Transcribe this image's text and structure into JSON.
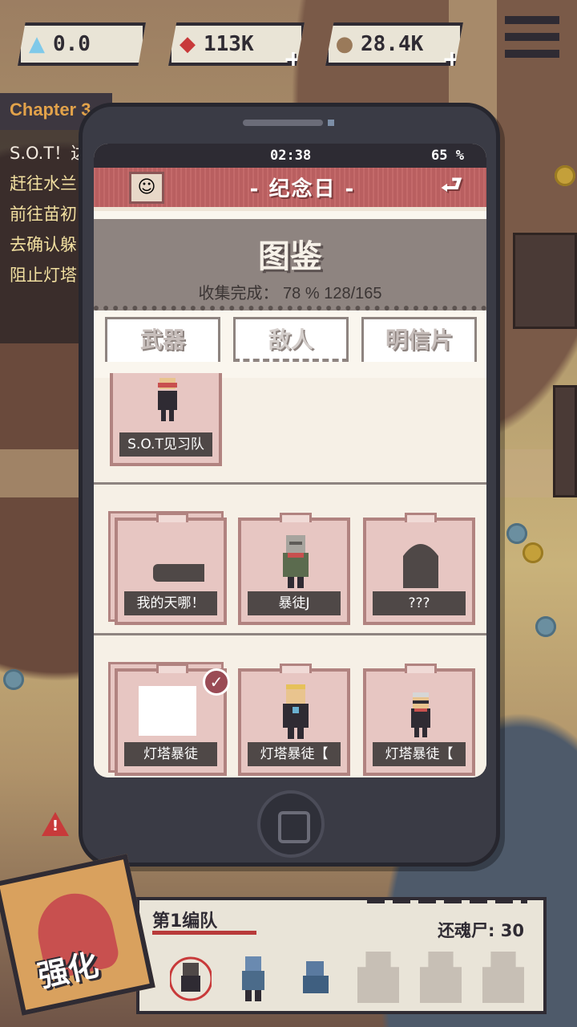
{
  "resources": [
    {
      "icon": "crystal-icon",
      "value": "0.0"
    },
    {
      "icon": "gem-icon",
      "value": "113K"
    },
    {
      "icon": "stone-icon",
      "value": "28.4K"
    }
  ],
  "quest_panel": {
    "chapter": "Chapter 3",
    "items": [
      "S.O.T！达",
      "赶往水兰",
      "前往苗初",
      "去确认躲",
      "阻止灯塔"
    ]
  },
  "phone": {
    "status": {
      "time": "02:38",
      "battery": "65 %"
    },
    "title": "- 纪念日 -",
    "header": {
      "title": "图鉴",
      "progress": "收集完成： 78 %  128/165"
    },
    "tabs": [
      "武器",
      "敌人",
      "明信片"
    ],
    "active_tab": "敌人",
    "cards": [
      {
        "name": "S.O.T见习队",
        "collected": false
      },
      {
        "name": "我的天哪！",
        "collected": false
      },
      {
        "name": "暴徒J",
        "collected": false
      },
      {
        "name": "???",
        "collected": false
      },
      {
        "name": "灯塔暴徒",
        "collected": true
      },
      {
        "name": "灯塔暴徒【",
        "collected": false
      },
      {
        "name": "灯塔暴徒【",
        "collected": false
      }
    ]
  },
  "team": {
    "name": "第1编队",
    "zombie_count": "还魂尸: 30"
  },
  "upgrade_button": {
    "label": "强化"
  },
  "colors": {
    "accent": "#c46a6a",
    "panel": "#e9e4d8",
    "dark": "#2f2b33"
  }
}
